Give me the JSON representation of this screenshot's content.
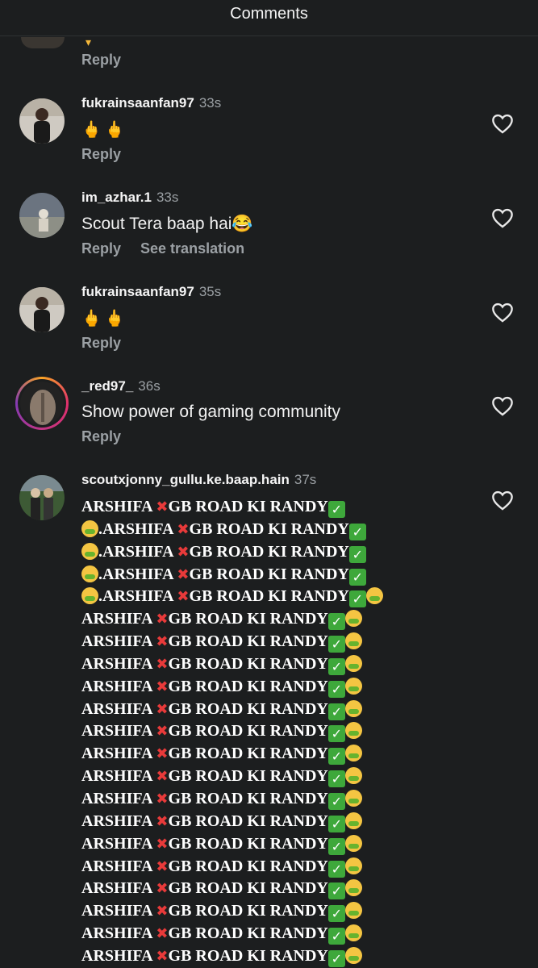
{
  "header": {
    "title": "Comments"
  },
  "top_fragment": {
    "reply_label": "Reply"
  },
  "comments": [
    {
      "username": "fukrainsaanfan97",
      "time": "33s",
      "text": "🖕🖕",
      "actions": [
        "Reply"
      ]
    },
    {
      "username": "im_azhar.1",
      "time": "33s",
      "text": "Scout Tera baap hai😂",
      "actions": [
        "Reply",
        "See translation"
      ]
    },
    {
      "username": "fukrainsaanfan97",
      "time": "35s",
      "text": "🖕🖕",
      "actions": [
        "Reply"
      ]
    },
    {
      "username": "_red97_",
      "time": "36s",
      "text": "Show power of gaming community",
      "actions": [
        "Reply"
      ]
    },
    {
      "username": "scoutxjonny_gullu.ke.baap.hain",
      "time": "37s",
      "lines": [
        "ARSHIFA ❌GB ROAD KI RANDY✅",
        "🤮.ARSHIFA ❌GB ROAD KI RANDY✅",
        "🤮.ARSHIFA ❌GB ROAD KI RANDY✅",
        "🤮.ARSHIFA ❌GB ROAD KI RANDY✅",
        "🤮.ARSHIFA ❌GB ROAD KI RANDY✅🤮",
        "ARSHIFA ❌GB ROAD KI RANDY✅🤮",
        "ARSHIFA ❌GB ROAD KI RANDY✅🤮",
        "ARSHIFA ❌GB ROAD KI RANDY✅🤮",
        "ARSHIFA ❌GB ROAD KI RANDY✅🤮",
        "ARSHIFA ❌GB ROAD KI RANDY✅🤮",
        "ARSHIFA ❌GB ROAD KI RANDY✅🤮",
        "ARSHIFA ❌GB ROAD KI RANDY✅🤮",
        "ARSHIFA ❌GB ROAD KI RANDY✅🤮",
        "ARSHIFA ❌GB ROAD KI RANDY✅🤮",
        "ARSHIFA ❌GB ROAD KI RANDY✅🤮",
        "ARSHIFA ❌GB ROAD KI RANDY✅🤮",
        "ARSHIFA ❌GB ROAD KI RANDY✅🤮",
        "ARSHIFA ❌GB ROAD KI RANDY✅🤮",
        "ARSHIFA ❌GB ROAD KI RANDY✅🤮",
        "ARSHIFA ❌GB ROAD KI RANDY✅🤮",
        "ARSHIFA ❌GB ROAD KI RANDY✅🤮"
      ]
    }
  ],
  "colors": {
    "background": "#1c1e1f",
    "secondary_text": "#9ba0a4",
    "story_ring": "#e1306c"
  },
  "icons": {
    "like": "heart-outline-icon"
  }
}
